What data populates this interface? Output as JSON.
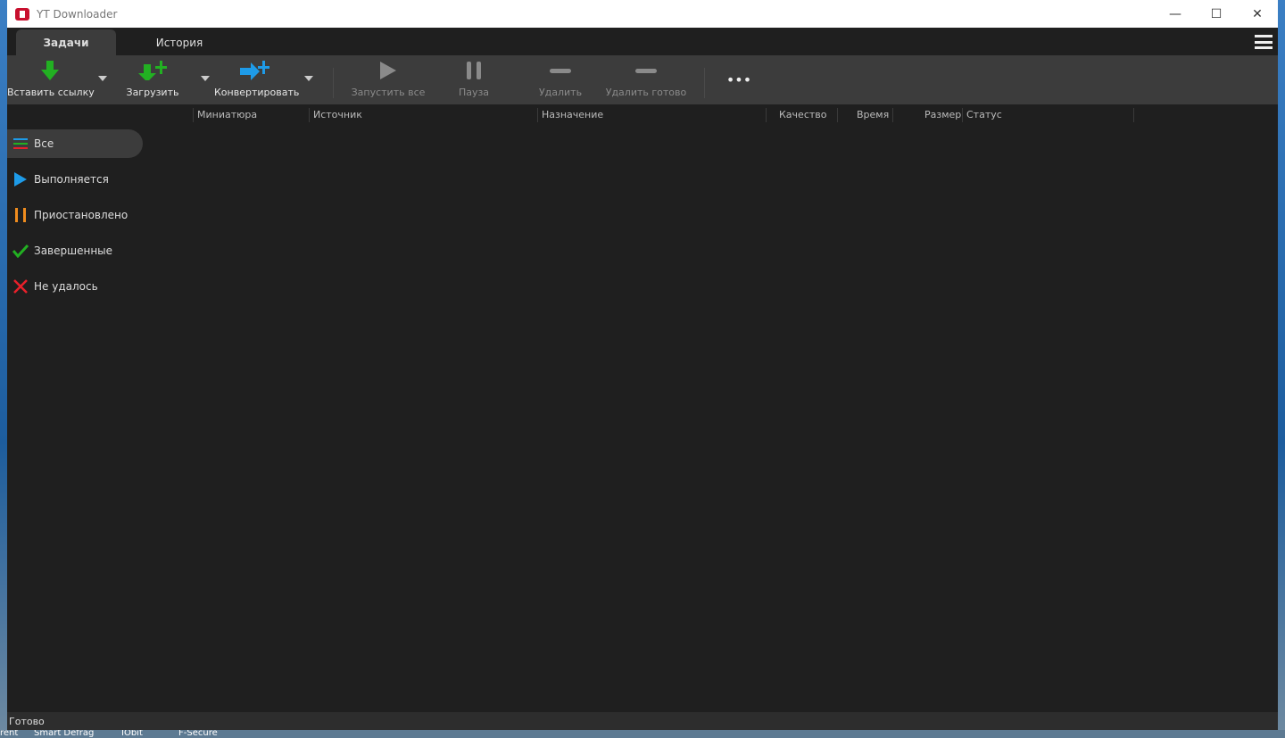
{
  "window": {
    "title": "YT Downloader",
    "minimize": "—",
    "maximize": "☐",
    "close": "✕"
  },
  "tabs": [
    {
      "label": "Задачи",
      "active": true
    },
    {
      "label": "История",
      "active": false
    }
  ],
  "toolbar": {
    "paste_link": "Вставить ссылку",
    "download": "Загрузить",
    "convert": "Конвертировать",
    "start_all": "Запустить все",
    "pause": "Пауза",
    "delete": "Удалить",
    "delete_done": "Удалить готово",
    "more": "•••"
  },
  "columns": [
    "Миниатюра",
    "Источник",
    "Назначение",
    "Качество",
    "Время",
    "Размер",
    "Статус"
  ],
  "sidebar": [
    {
      "label": "Все",
      "icon": "list-icon",
      "active": true
    },
    {
      "label": "Выполняется",
      "icon": "play-icon"
    },
    {
      "label": "Приостановлено",
      "icon": "pause-icon"
    },
    {
      "label": "Завершенные",
      "icon": "check-icon"
    },
    {
      "label": "Не удалось",
      "icon": "x-icon"
    }
  ],
  "status": "Готово",
  "taskbar": [
    "rent",
    "Smart Defrag",
    "IObit",
    "F-Secure"
  ],
  "colors": {
    "green": "#22b022",
    "blue": "#1e9be8",
    "orange": "#f08c1e",
    "red": "#e8202a",
    "toolbar": "#3c3c3c",
    "background": "#1f1f1f"
  }
}
